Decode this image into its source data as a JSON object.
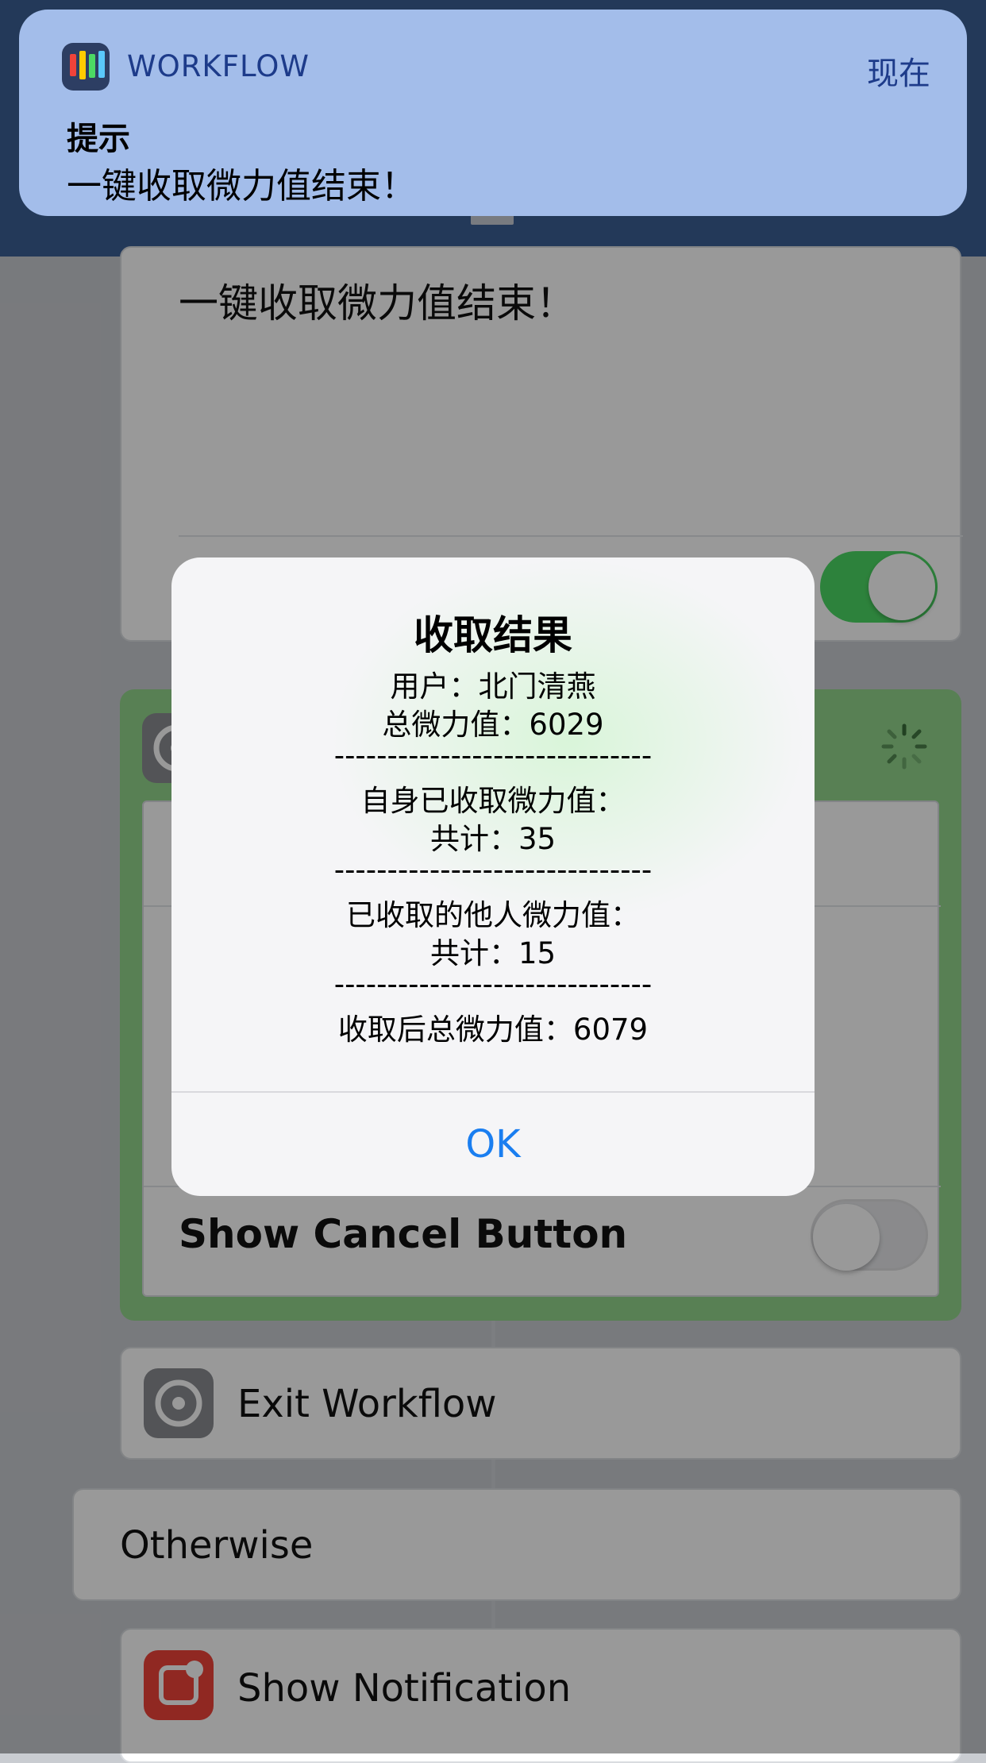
{
  "banner": {
    "app_name": "WORKFLOW",
    "time": "现在",
    "title": "提示",
    "body": "一键收取微力值结束！"
  },
  "text_card": {
    "content": "一键收取微力值结束！",
    "toggle_on": true
  },
  "show_alert_card": {
    "cancel_label": "Show Cancel Button",
    "cancel_toggle_on": false
  },
  "exit_card": {
    "label": "Exit Workflow",
    "icon": "gear-icon"
  },
  "otherwise_card": {
    "label": "Otherwise"
  },
  "notification_card": {
    "label": "Show Notification",
    "icon": "notification-icon"
  },
  "alert": {
    "title": "收取结果",
    "line_user": "用户：北门清燕",
    "line_total": "总微力值：6029",
    "separator": "------------------------------",
    "line_self_header": "自身已收取微力值：",
    "line_self_total": "共计：35",
    "line_others_header": "已收取的他人微力值：",
    "line_others_total": "共计：15",
    "line_after": "收取后总微力值：6079",
    "ok_label": "OK"
  },
  "colors": {
    "accent": "#1a7ef0",
    "toggle_on": "#4cd964",
    "green_wrap": "#93d58d",
    "nav": "#3b5f95"
  }
}
